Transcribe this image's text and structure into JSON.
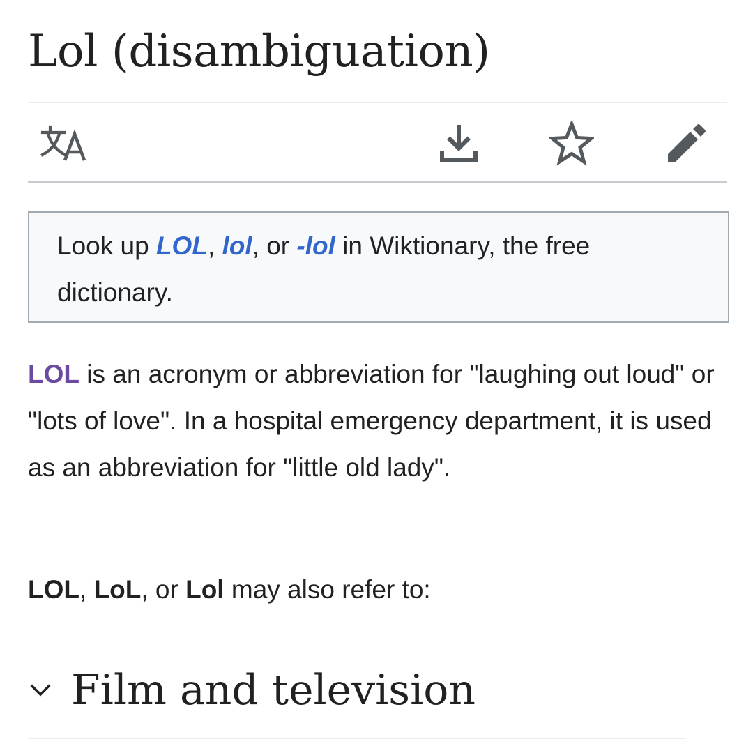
{
  "page": {
    "title": "Lol (disambiguation)"
  },
  "toolbar": {
    "icons": [
      "language-icon",
      "download-icon",
      "star-icon",
      "pencil-icon"
    ]
  },
  "wiktionary_box": {
    "prefix": "Look up ",
    "link1": "LOL",
    "sep1": ", ",
    "link2": "lol",
    "sep2": ", or ",
    "link3": "-lol",
    "suffix": " in Wiktionary, the free dictionary."
  },
  "intro": {
    "term": "LOL",
    "text": " is an acronym or abbreviation for \"laughing out loud\" or \"lots of love\". In a hospital emergency department, it is used as an abbreviation for \"little old lady\"."
  },
  "refer": {
    "term1": "LOL",
    "sep1": ", ",
    "term2": "LoL",
    "sep2": ", or ",
    "term3": "Lol",
    "suffix": " may also refer to:"
  },
  "sections": [
    {
      "title": "Film and television",
      "icon": "chevron-down-icon"
    }
  ],
  "colors": {
    "link": "#3366cc",
    "visited_link": "#6b4ba1",
    "text": "#202122",
    "icon": "#54595d",
    "box_bg": "#f8f9fa",
    "box_border": "#a2a9b1"
  }
}
